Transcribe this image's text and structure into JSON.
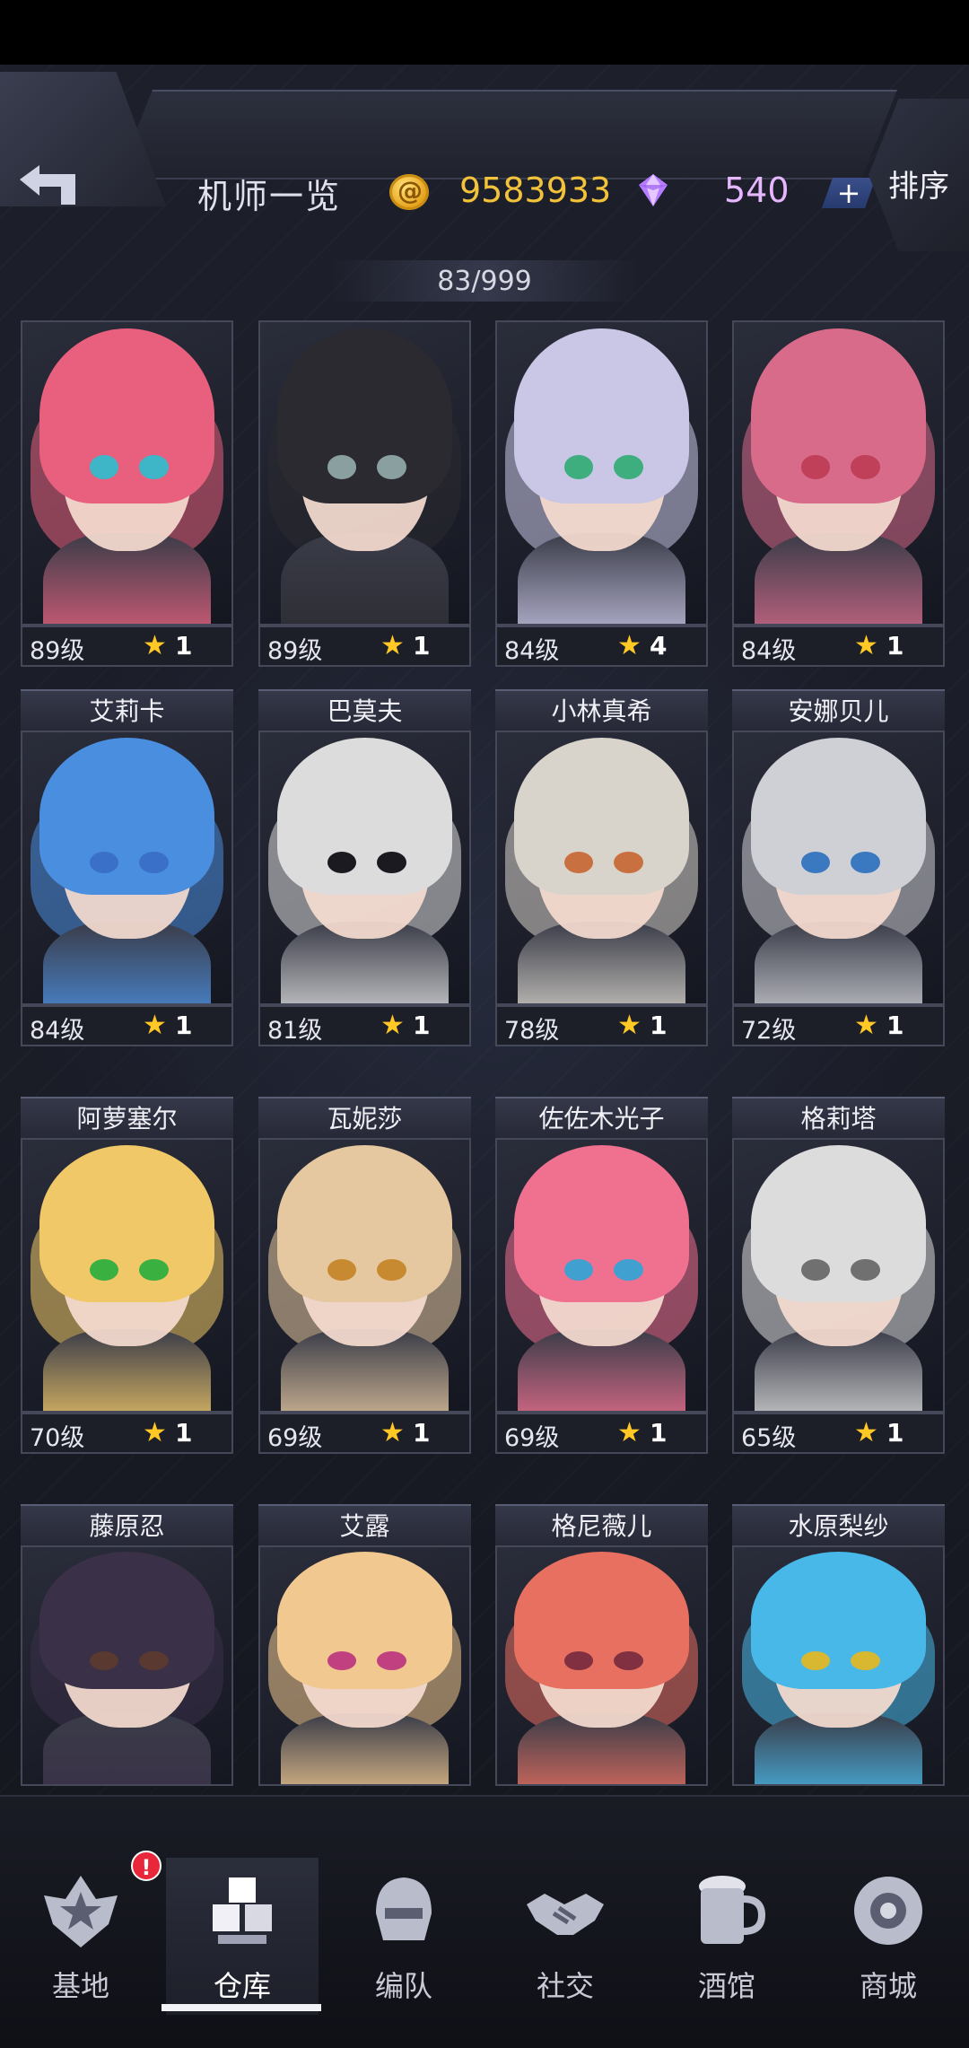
{
  "header": {
    "title": "机师一览",
    "gold": "9583933",
    "gems": "540",
    "plus_label": "+",
    "sort_label": "排序"
  },
  "roster_count": "83/999",
  "colors": {
    "gold": "#f2c23a",
    "gem": "#e6b6ff",
    "star": "#ffc824",
    "alert": "#e8283a"
  },
  "pilots": [
    {
      "name": "",
      "level": "89级",
      "stars": "1",
      "hair": "#e8607e",
      "eye": "#3fb6c8"
    },
    {
      "name": "",
      "level": "89级",
      "stars": "1",
      "hair": "#2a2a30",
      "eye": "#8aa0a0"
    },
    {
      "name": "",
      "level": "84级",
      "stars": "4",
      "hair": "#c9c6e6",
      "eye": "#3fae7e"
    },
    {
      "name": "",
      "level": "84级",
      "stars": "1",
      "hair": "#d86a8a",
      "eye": "#c0405a"
    },
    {
      "name": "艾莉卡",
      "level": "84级",
      "stars": "1",
      "hair": "#4a8ee0",
      "eye": "#3a70c8"
    },
    {
      "name": "巴莫夫",
      "level": "81级",
      "stars": "1",
      "hair": "#dcdcdc",
      "eye": "#1a1a20"
    },
    {
      "name": "小林真希",
      "level": "78级",
      "stars": "1",
      "hair": "#d8d4cc",
      "eye": "#c87040"
    },
    {
      "name": "安娜贝儿",
      "level": "72级",
      "stars": "1",
      "hair": "#cfd0d6",
      "eye": "#3a78c0"
    },
    {
      "name": "阿萝塞尔",
      "level": "70级",
      "stars": "1",
      "hair": "#f0c868",
      "eye": "#3ab040"
    },
    {
      "name": "瓦妮莎",
      "level": "69级",
      "stars": "1",
      "hair": "#e6c8a0",
      "eye": "#c88a30"
    },
    {
      "name": "佐佐木光子",
      "level": "69级",
      "stars": "1",
      "hair": "#f07090",
      "eye": "#40a0d0"
    },
    {
      "name": "格莉塔",
      "level": "65级",
      "stars": "1",
      "hair": "#dcdcdc",
      "eye": "#707070"
    },
    {
      "name": "藤原忍",
      "level": "",
      "stars": "",
      "hair": "#3a3048",
      "eye": "#5a3a30"
    },
    {
      "name": "艾露",
      "level": "",
      "stars": "",
      "hair": "#f0c890",
      "eye": "#c04080"
    },
    {
      "name": "格尼薇儿",
      "level": "",
      "stars": "",
      "hair": "#e87060",
      "eye": "#803040"
    },
    {
      "name": "水原梨纱",
      "level": "",
      "stars": "",
      "hair": "#48b8e8",
      "eye": "#d8b830"
    }
  ],
  "nav": [
    {
      "label": "基地",
      "icon": "base-emblem-icon"
    },
    {
      "label": "仓库",
      "icon": "warehouse-cubes-icon"
    },
    {
      "label": "编队",
      "icon": "mech-helmet-icon"
    },
    {
      "label": "社交",
      "icon": "handshake-icon"
    },
    {
      "label": "酒馆",
      "icon": "beer-mug-icon"
    },
    {
      "label": "商城",
      "icon": "shop-orb-icon"
    }
  ],
  "base_alert": "!"
}
